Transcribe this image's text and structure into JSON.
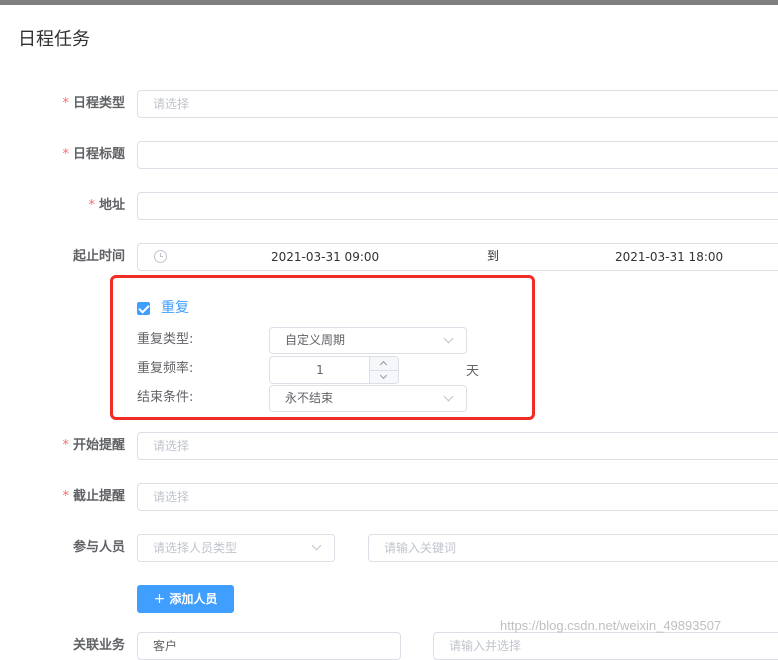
{
  "page_title": "日程任务",
  "form": {
    "schedule_type": {
      "label": "日程类型",
      "placeholder": "请选择"
    },
    "schedule_title": {
      "label": "日程标题",
      "value": ""
    },
    "address": {
      "label": "地址",
      "value": ""
    },
    "time_range": {
      "label": "起止时间",
      "start": "2021-03-31 09:00",
      "separator": "到",
      "end": "2021-03-31 18:00"
    },
    "repeat": {
      "checkbox_label": "重复",
      "checked": true,
      "type_label": "重复类型:",
      "type_value": "自定义周期",
      "freq_label": "重复频率:",
      "freq_value": "1",
      "freq_unit": "天",
      "end_label": "结束条件:",
      "end_value": "永不结束"
    },
    "start_reminder": {
      "label": "开始提醒",
      "placeholder": "请选择"
    },
    "deadline_reminder": {
      "label": "截止提醒",
      "placeholder": "请选择"
    },
    "participants": {
      "label": "参与人员",
      "type_placeholder": "请选择人员类型",
      "keyword_placeholder": "请输入关键词",
      "add_button": "添加人员"
    },
    "related_business": {
      "label": "关联业务",
      "type_value": "客户",
      "placeholder": "请输入并选择"
    }
  },
  "highlight_color": "#ef2d24",
  "accent_color": "#409eff",
  "watermark": "https://blog.csdn.net/weixin_49893507"
}
